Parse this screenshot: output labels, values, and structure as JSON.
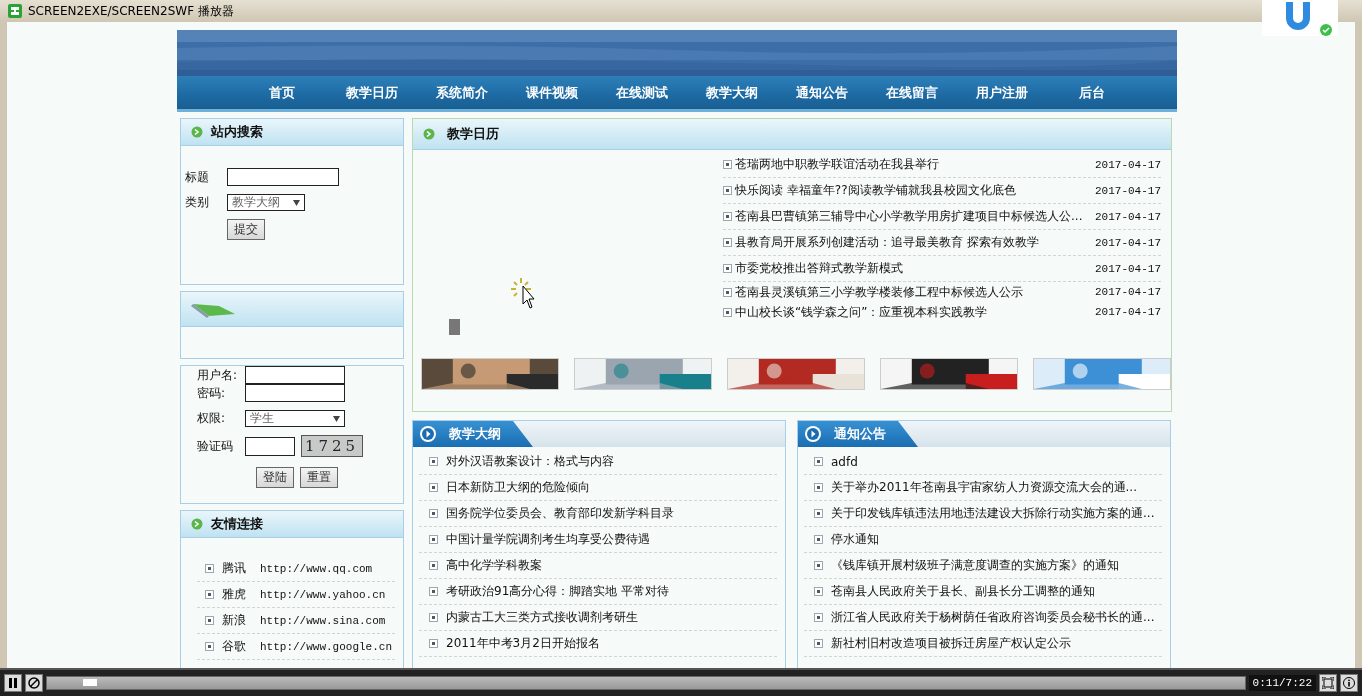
{
  "window": {
    "title": "SCREEN2EXE/SCREEN2SWF 播放器"
  },
  "nav": [
    {
      "label": "首页"
    },
    {
      "label": "教学日历"
    },
    {
      "label": "系统简介"
    },
    {
      "label": "课件视频"
    },
    {
      "label": "在线测试"
    },
    {
      "label": "教学大纲"
    },
    {
      "label": "通知公告"
    },
    {
      "label": "在线留言"
    },
    {
      "label": "用户注册"
    },
    {
      "label": "后台"
    }
  ],
  "search_panel": {
    "title": "站内搜索",
    "title_label": "标题",
    "category_label": "类别",
    "category": "教学大纲",
    "submit": "提交"
  },
  "login_panel": {
    "username_label": "用户名:",
    "password_label": "密码:",
    "role_label": "权限:",
    "role": "学生",
    "captcha_label": "验证码",
    "captcha": "1725",
    "buttons": [
      "登陆",
      "重置"
    ]
  },
  "links_panel": {
    "title": "友情连接",
    "items": [
      {
        "name": "腾讯",
        "url": "http://www.qq.com"
      },
      {
        "name": "雅虎",
        "url": "http://www.yahoo.cn"
      },
      {
        "name": "新浪",
        "url": "http://www.sina.com"
      },
      {
        "name": "谷歌",
        "url": "http://www.google.cn"
      }
    ]
  },
  "calendar_panel": {
    "title": "教学日历",
    "items": [
      {
        "title": "苍瑞两地中职教学联谊活动在我县举行",
        "date": "2017-04-17"
      },
      {
        "title": "快乐阅读 幸福童年??阅读教学铺就我县校园文化底色",
        "date": "2017-04-17"
      },
      {
        "title": "苍南县巴曹镇第三辅导中心小学教学用房扩建项目中标候选人公...",
        "date": "2017-04-17"
      },
      {
        "title": "县教育局开展系列创建活动：追寻最美教育 探索有效教学",
        "date": "2017-04-17"
      },
      {
        "title": "市委党校推出答辩式教学新模式",
        "date": "2017-04-17"
      },
      {
        "title": "苍南县灵溪镇第三小学教学楼装修工程中标候选人公示",
        "date": "2017-04-17"
      },
      {
        "title": "中山校长谈“钱学森之问”：应重视本科实践教学",
        "date": "2017-04-17"
      }
    ]
  },
  "syllabus_panel": {
    "title": "教学大纲",
    "items": [
      {
        "title": "对外汉语教案设计：格式与内容"
      },
      {
        "title": "日本新防卫大纲的危险倾向"
      },
      {
        "title": "国务院学位委员会、教育部印发新学科目录"
      },
      {
        "title": "中国计量学院调剂考生均享受公费待遇"
      },
      {
        "title": "高中化学学科教案"
      },
      {
        "title": "考研政治91高分心得：脚踏实地 平常对待"
      },
      {
        "title": "内蒙古工大三类方式接收调剂考研生"
      },
      {
        "title": "2011年中考3月2日开始报名"
      }
    ]
  },
  "notice_panel": {
    "title": "通知公告",
    "items": [
      {
        "title": "adfd"
      },
      {
        "title": "关于举办2011年苍南县宇宙家纺人力资源交流大会的通..."
      },
      {
        "title": "关于印发钱库镇违法用地违法建设大拆除行动实施方案的通..."
      },
      {
        "title": "停水通知"
      },
      {
        "title": "《钱库镇开展村级班子满意度调查的实施方案》的通知"
      },
      {
        "title": "苍南县人民政府关于县长、副县长分工调整的通知"
      },
      {
        "title": "浙江省人民政府关于杨树荫任省政府咨询委员会秘书长的通..."
      },
      {
        "title": "新社村旧村改造项目被拆迁房屋产权认定公示"
      }
    ]
  },
  "player": {
    "playing": true,
    "level": 0.03,
    "time": "0:11/7:22"
  }
}
